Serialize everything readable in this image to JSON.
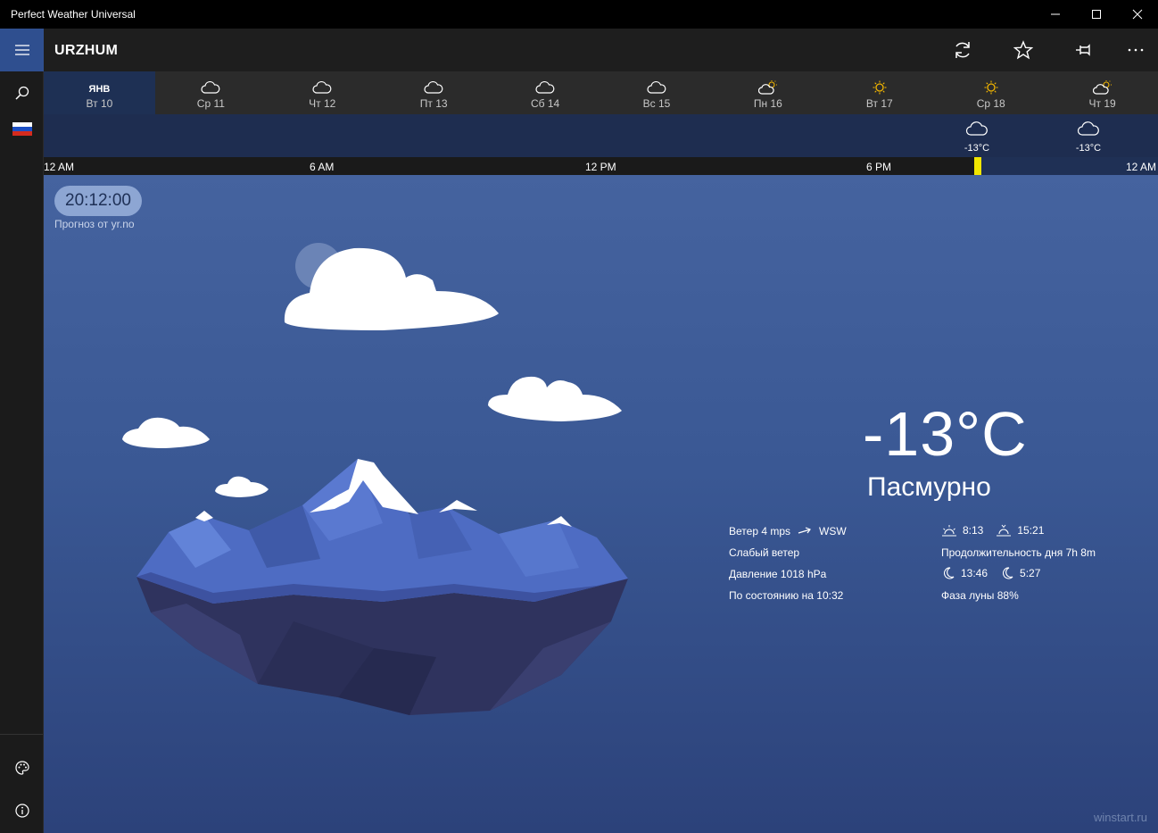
{
  "window": {
    "title": "Perfect Weather Universal"
  },
  "header": {
    "city": "URZHUM"
  },
  "days": [
    {
      "month": "ЯНВ",
      "label": "Вт 10",
      "icon": "cloud-icon",
      "active": true
    },
    {
      "label": "Ср 11",
      "icon": "cloud-icon"
    },
    {
      "label": "Чт 12",
      "icon": "cloud-icon"
    },
    {
      "label": "Пт 13",
      "icon": "cloud-icon"
    },
    {
      "label": "Сб 14",
      "icon": "cloud-icon"
    },
    {
      "label": "Вс 15",
      "icon": "cloud-icon"
    },
    {
      "label": "Пн 16",
      "icon": "partly-sunny-icon"
    },
    {
      "label": "Вт 17",
      "icon": "sun-icon"
    },
    {
      "label": "Ср 18",
      "icon": "sun-icon"
    },
    {
      "label": "Чт 19",
      "icon": "partly-sunny-icon"
    }
  ],
  "hourly": [
    {
      "temp": "-13°C",
      "icon": "cloud-icon"
    },
    {
      "temp": "-13°C",
      "icon": "cloud-icon"
    }
  ],
  "timeline": {
    "ticks": [
      "12 AM",
      "6 AM",
      "12 PM",
      "6 PM",
      "12 AM"
    ]
  },
  "current": {
    "clock": "20:12:00",
    "source": "Прогноз от yr.no",
    "temperature": "-13°C",
    "condition": "Пасмурно",
    "wind": "Ветер 4 mps",
    "wind_dir": "WSW",
    "wind_desc": "Слабый ветер",
    "pressure": "Давление 1018 hPa",
    "updated": "По состоянию на 10:32",
    "sunrise": "8:13",
    "sunset": "15:21",
    "day_length": "Продолжительность дня 7h 8m",
    "moonrise": "13:46",
    "moonset": "5:27",
    "moon_phase": "Фаза луны 88%"
  },
  "watermark": "winstart.ru",
  "colors": {
    "accent": "#2f4f8f",
    "marker": "#f2e600",
    "sun": "#f2b600"
  }
}
